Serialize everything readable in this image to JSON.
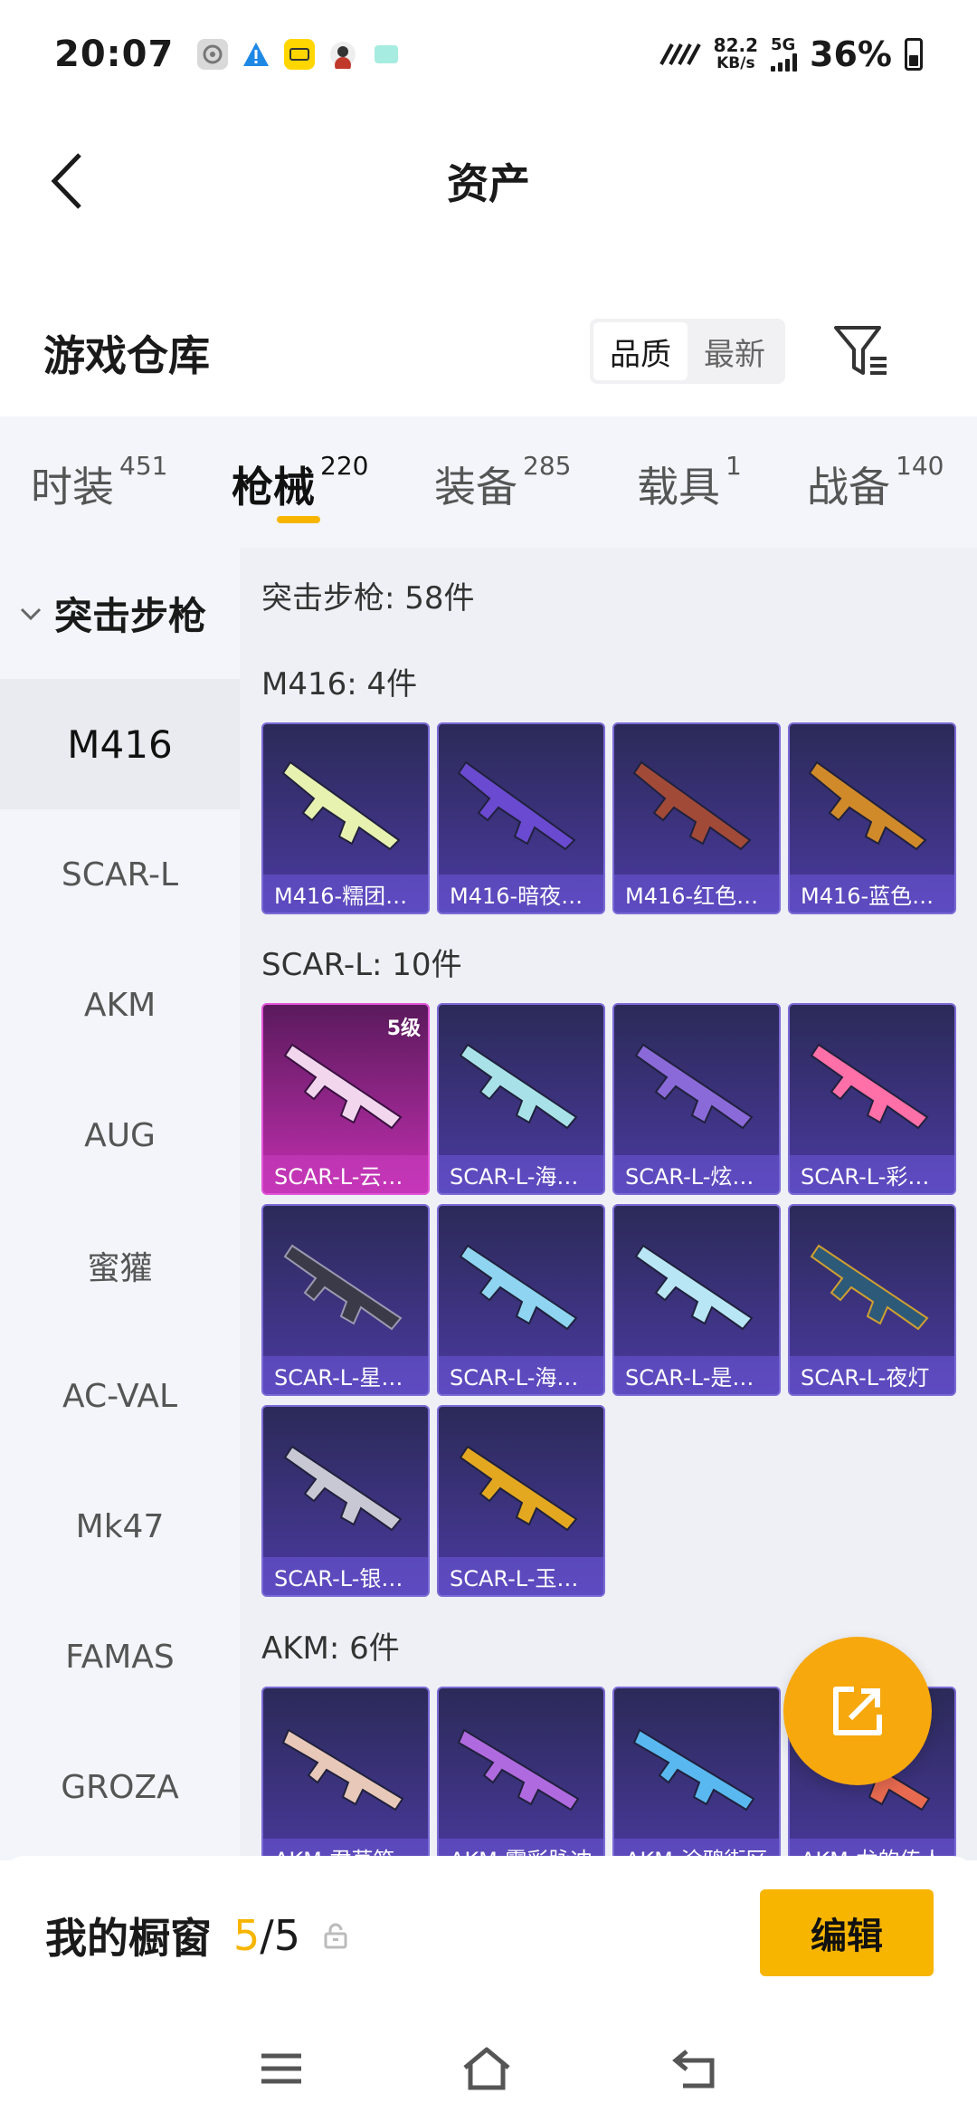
{
  "status_bar": {
    "time": "20:07",
    "net_speed_value": "82.2",
    "net_speed_unit": "KB/s",
    "network_type": "5G",
    "battery_percent": "36%"
  },
  "header": {
    "title": "资产"
  },
  "warehouse": {
    "title": "游戏仓库",
    "sort_options": [
      "品质",
      "最新"
    ],
    "active_sort": "品质"
  },
  "tabs": [
    {
      "label": "时装",
      "count": "451"
    },
    {
      "label": "枪械",
      "count": "220",
      "active": true
    },
    {
      "label": "装备",
      "count": "285"
    },
    {
      "label": "载具",
      "count": "1"
    },
    {
      "label": "战备",
      "count": "140"
    }
  ],
  "sidebar": {
    "group": "突击步枪",
    "items": [
      "M416",
      "SCAR-L",
      "AKM",
      "AUG",
      "蜜獾",
      "AC-VAL",
      "Mk47",
      "FAMAS",
      "GROZA"
    ],
    "active": "M416"
  },
  "main": {
    "summary": "突击步枪: 58件",
    "sections": [
      {
        "title": "M416: 4件",
        "cards": [
          "M416-糯团…",
          "M416-暗夜…",
          "M416-红色…",
          "M416-蓝色…"
        ]
      },
      {
        "title": "SCAR-L: 10件",
        "cards": [
          "SCAR-L-云…",
          "SCAR-L-海…",
          "SCAR-L-炫…",
          "SCAR-L-彩…",
          "SCAR-L-星…",
          "SCAR-L-海…",
          "SCAR-L-是…",
          "SCAR-L-夜灯",
          "SCAR-L-银…",
          "SCAR-L-玉…"
        ],
        "first_level": "5级"
      },
      {
        "title": "AKM: 6件",
        "cards": [
          "AKM-君草笔",
          "AKM-霓彩脉冲",
          "AKM-涂鸦街区",
          "AKM-龙的传人"
        ]
      }
    ]
  },
  "showcase": {
    "title": "我的橱窗",
    "current": "5",
    "total": "/5",
    "edit_label": "编辑"
  },
  "colors": {
    "accent": "#f7b500",
    "card_purple": "#4b3aa0",
    "card_pink": "#c22fb0"
  }
}
